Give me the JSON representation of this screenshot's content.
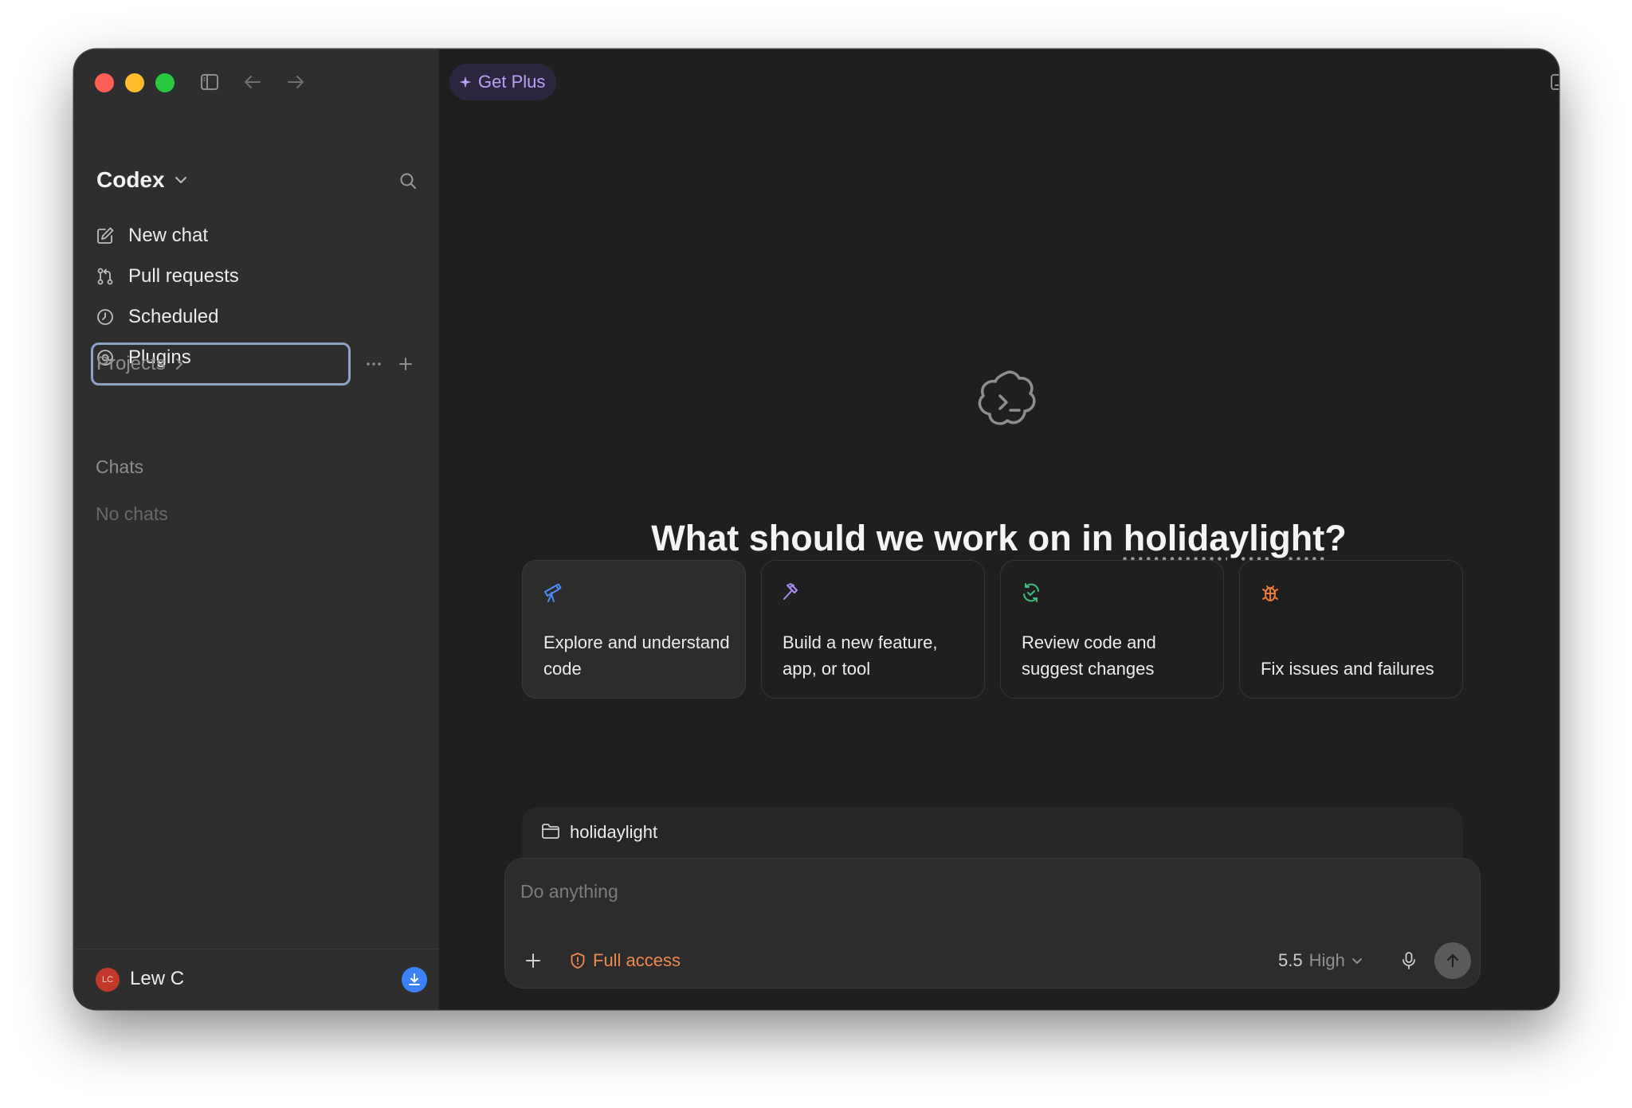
{
  "app": {
    "name": "Codex"
  },
  "header": {
    "get_plus_label": "Get Plus"
  },
  "sidebar": {
    "nav": [
      {
        "label": "New chat",
        "icon": "edit-icon"
      },
      {
        "label": "Pull requests",
        "icon": "git-pull-request-icon"
      },
      {
        "label": "Scheduled",
        "icon": "clock-icon"
      },
      {
        "label": "Plugins",
        "icon": "at-sign-icon"
      }
    ],
    "projects_label": "Projects",
    "chats_heading": "Chats",
    "no_chats": "No chats",
    "user": {
      "initials": "LC",
      "name": "Lew C"
    }
  },
  "main": {
    "title_prefix": "What should we work on in ",
    "title_project": "holidaylight",
    "title_suffix": "?",
    "cards": [
      {
        "label": "Explore and understand code",
        "icon": "telescope-icon",
        "color": "#4a8df7"
      },
      {
        "label": "Build a new feature, app, or tool",
        "icon": "hammer-icon",
        "color": "#a98cf5"
      },
      {
        "label": "Review code and suggest changes",
        "icon": "refresh-check-icon",
        "color": "#3fbf7f"
      },
      {
        "label": "Fix issues and failures",
        "icon": "bug-icon",
        "color": "#f07a3a"
      }
    ]
  },
  "composer": {
    "project": "holidaylight",
    "placeholder": "Do anything",
    "access_label": "Full access",
    "model_version": "5.5",
    "model_effort": "High"
  },
  "colors": {
    "accent_purple": "#b9a2f5",
    "access_orange": "#f0894c",
    "download_blue": "#3b82f6"
  }
}
